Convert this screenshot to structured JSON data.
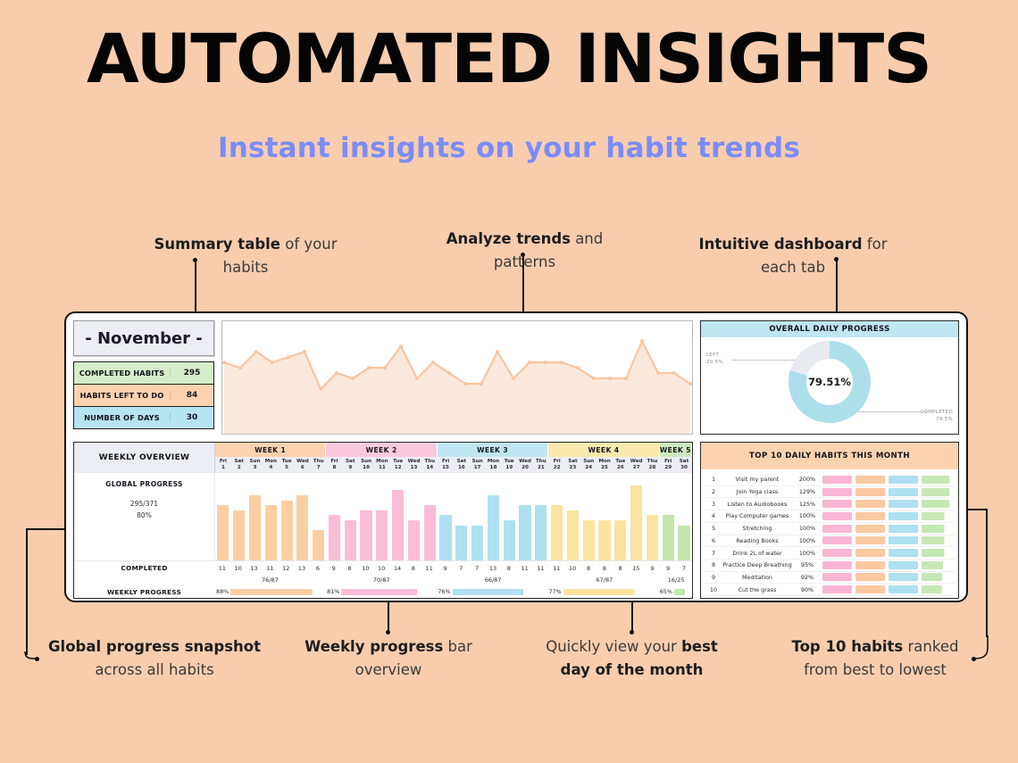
{
  "header": {
    "title": "AUTOMATED INSIGHTS",
    "subtitle": "Instant insights on your habit trends",
    "title_color": "#050505",
    "subtitle_color": "#7b8cfa",
    "background_color": "#f8cdae"
  },
  "callouts": [
    {
      "id": "summary-table",
      "bold": "Summary table",
      "rest": " of your",
      "line2": "habits"
    },
    {
      "id": "analyze-trends",
      "bold": "Analyze trends",
      "rest": " and",
      "line2": "patterns"
    },
    {
      "id": "intuitive-dashboard",
      "bold": "Intuitive dashboard",
      "rest": " for",
      "line2": "each tab"
    },
    {
      "id": "global-progress",
      "bold": "Global progress snapshot",
      "rest": "",
      "line2": "across all habits"
    },
    {
      "id": "weekly-progress",
      "bold": "Weekly progress",
      "rest": " bar",
      "line2": "overview"
    },
    {
      "id": "best-day",
      "pre": "Quickly view your ",
      "bold": "best",
      "line2bold": "day of the month"
    },
    {
      "id": "top-10",
      "bold": "Top 10 habits",
      "rest": " ranked",
      "line2": "from best to lowest"
    }
  ],
  "summary": {
    "month_label": "- November -",
    "rows": [
      {
        "label": "COMPLETED HABITS",
        "value": "295",
        "color": "#d6edc9"
      },
      {
        "label": "HABITS LEFT TO DO",
        "value": "84",
        "color": "#fbd3b0"
      },
      {
        "label": "NUMBER OF DAYS",
        "value": "30",
        "color": "#b6e4f1"
      }
    ]
  },
  "donut": {
    "title": "OVERALL DAILY PROGRESS",
    "center_value": "79.51%",
    "left_label": "LEFT",
    "left_value": "20.5%",
    "right_label": "COMPLETED",
    "right_value": "79.5%",
    "completed_pct": 79.51,
    "left_pct": 20.49,
    "completed_color": "#addfeb",
    "left_color": "#e8eaf0"
  },
  "weekly": {
    "title": "WEEKLY OVERVIEW",
    "global_progress_label": "GLOBAL PROGRESS",
    "global_fraction": "295/371",
    "global_pct": "80%",
    "completed_label": "COMPLETED",
    "weekly_progress_label": "WEEKLY PROGRESS",
    "weeks": [
      {
        "name": "WEEK 1",
        "color": "#fbd3b0",
        "bar_color": "#fbcfa3",
        "days": [
          {
            "dow": "Fri",
            "num": "1"
          },
          {
            "dow": "Sat",
            "num": "2"
          },
          {
            "dow": "Sun",
            "num": "3"
          },
          {
            "dow": "Mon",
            "num": "4"
          },
          {
            "dow": "Tue",
            "num": "5"
          },
          {
            "dow": "Wed",
            "num": "6"
          },
          {
            "dow": "Thu",
            "num": "7"
          }
        ],
        "completed": [
          11,
          10,
          13,
          11,
          12,
          13,
          6
        ],
        "fraction": "76/87",
        "pct": "88%",
        "pct_value": 88
      },
      {
        "name": "WEEK 2",
        "color": "#fbc9dd",
        "bar_color": "#fbbcd8",
        "days": [
          {
            "dow": "Fri",
            "num": "8"
          },
          {
            "dow": "Sat",
            "num": "9"
          },
          {
            "dow": "Sun",
            "num": "10"
          },
          {
            "dow": "Mon",
            "num": "11"
          },
          {
            "dow": "Tue",
            "num": "12"
          },
          {
            "dow": "Wed",
            "num": "13"
          },
          {
            "dow": "Thu",
            "num": "14"
          }
        ],
        "completed": [
          9,
          8,
          10,
          10,
          14,
          8,
          11
        ],
        "fraction": "70/87",
        "pct": "81%",
        "pct_value": 81
      },
      {
        "name": "WEEK 3",
        "color": "#bfe6f2",
        "bar_color": "#aee0f0",
        "days": [
          {
            "dow": "Fri",
            "num": "15"
          },
          {
            "dow": "Sat",
            "num": "16"
          },
          {
            "dow": "Sun",
            "num": "17"
          },
          {
            "dow": "Mon",
            "num": "18"
          },
          {
            "dow": "Tue",
            "num": "19"
          },
          {
            "dow": "Wed",
            "num": "20"
          },
          {
            "dow": "Thu",
            "num": "21"
          }
        ],
        "completed": [
          9,
          7,
          7,
          13,
          8,
          11,
          11
        ],
        "fraction": "66/87",
        "pct": "76%",
        "pct_value": 76
      },
      {
        "name": "WEEK 4",
        "color": "#fbe9ae",
        "bar_color": "#fbe3a0",
        "days": [
          {
            "dow": "Fri",
            "num": "22"
          },
          {
            "dow": "Sat",
            "num": "23"
          },
          {
            "dow": "Sun",
            "num": "24"
          },
          {
            "dow": "Mon",
            "num": "25"
          },
          {
            "dow": "Tue",
            "num": "26"
          },
          {
            "dow": "Wed",
            "num": "27"
          },
          {
            "dow": "Thu",
            "num": "28"
          }
        ],
        "completed": [
          11,
          10,
          8,
          8,
          8,
          15,
          9
        ],
        "fraction": "67/87",
        "pct": "77%",
        "pct_value": 77
      },
      {
        "name": "WEEK 5",
        "color": "#cfe9bf",
        "bar_color": "#c3e5ae",
        "days": [
          {
            "dow": "Fri",
            "num": "29"
          },
          {
            "dow": "Sat",
            "num": "30"
          }
        ],
        "completed": [
          9,
          7
        ],
        "fraction": "16/25",
        "pct": "65%",
        "pct_value": 65
      }
    ],
    "max_bar": 15
  },
  "top10": {
    "title": "TOP 10 DAILY HABITS THIS MONTH",
    "segment_colors": [
      "#fbb6d4",
      "#fbc9a0",
      "#aee0f0",
      "#c6e8b4"
    ],
    "rows": [
      {
        "rank": "1",
        "name": "Visit my parent",
        "pct": "200%",
        "value": 200
      },
      {
        "rank": "2",
        "name": "Join Yoga class",
        "pct": "129%",
        "value": 129
      },
      {
        "rank": "3",
        "name": "Listen to Audiobooks",
        "pct": "125%",
        "value": 125
      },
      {
        "rank": "4",
        "name": "Play Computer games",
        "pct": "100%",
        "value": 100
      },
      {
        "rank": "5",
        "name": "Stretching",
        "pct": "100%",
        "value": 100
      },
      {
        "rank": "6",
        "name": "Reading Books",
        "pct": "100%",
        "value": 100
      },
      {
        "rank": "7",
        "name": "Drink 2L of water",
        "pct": "100%",
        "value": 100
      },
      {
        "rank": "8",
        "name": "Practice Deep Breathing",
        "pct": "95%",
        "value": 95
      },
      {
        "rank": "9",
        "name": "Meditation",
        "pct": "92%",
        "value": 92
      },
      {
        "rank": "10",
        "name": "Cut the grass",
        "pct": "90%",
        "value": 90
      }
    ]
  },
  "chart_data": {
    "type": "line",
    "title": "",
    "xlabel": "",
    "ylabel": "",
    "grid": false,
    "line_color": "#f8c6a2",
    "fill_color": "#fde9dc",
    "x": [
      1,
      2,
      3,
      4,
      5,
      6,
      7,
      8,
      9,
      10,
      11,
      12,
      13,
      14,
      15,
      16,
      17,
      18,
      19,
      20,
      21,
      22,
      23,
      24,
      25,
      26,
      27,
      28,
      29,
      30
    ],
    "values": [
      11,
      10,
      13,
      11,
      12,
      13,
      6,
      9,
      8,
      10,
      10,
      14,
      8,
      11,
      9,
      7,
      7,
      13,
      8,
      11,
      11,
      11,
      10,
      8,
      8,
      8,
      15,
      9,
      9,
      7
    ],
    "ylim": [
      0,
      16
    ]
  }
}
